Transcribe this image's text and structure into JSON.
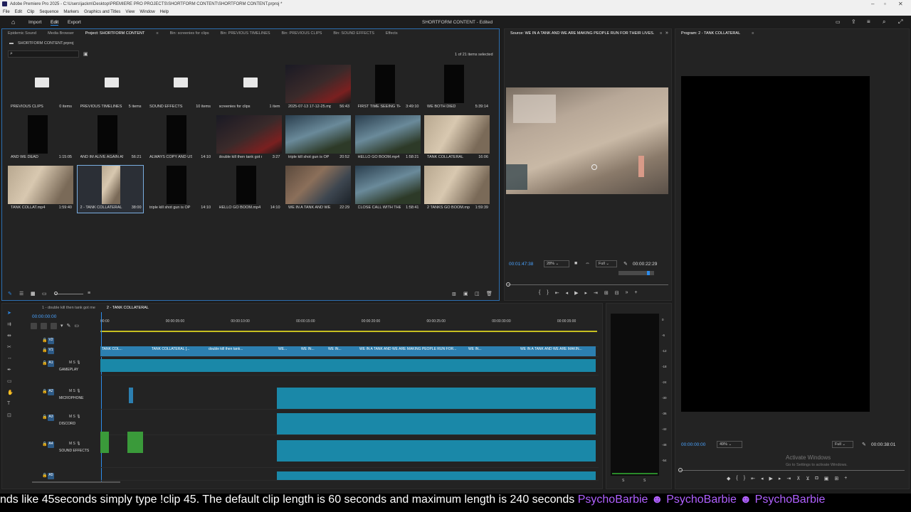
{
  "titlebar": {
    "title": "Adobe Premiere Pro 2025 - C:\\Users\\jackm\\Desktop\\PREMIERE PRO PROJECTS\\SHORTFORM CONTENT\\SHORTFORM CONTENT.prproj *"
  },
  "menu": [
    "File",
    "Edit",
    "Clip",
    "Sequence",
    "Markers",
    "Graphics and Titles",
    "View",
    "Window",
    "Help"
  ],
  "appbar": {
    "import": "Import",
    "edit": "Edit",
    "export": "Export",
    "project_title": "SHORTFORM CONTENT - Edited"
  },
  "project_tabs": [
    "Epidemic Sound",
    "Media Browser",
    "Project: SHORTFORM CONTENT",
    "Bin: screenies for clips",
    "Bin: PREVIOUS TIMELINES",
    "Bin: PREVIOUS CLIPS",
    "Bin: SOUND EFFECTS",
    "Effects"
  ],
  "project": {
    "file": "SHORTFORM CONTENT.prproj",
    "selected": "1 of 21 items selected",
    "search_placeholder": ""
  },
  "items": [
    {
      "name": "PREVIOUS CLIPS",
      "dur": "0 items",
      "kind": "folder"
    },
    {
      "name": "PREVIOUS TIMELINES",
      "dur": "5 items",
      "kind": "folder"
    },
    {
      "name": "SOUND EFFECTS",
      "dur": "10 items",
      "kind": "folder"
    },
    {
      "name": "screenies for clips",
      "dur": "1 item",
      "kind": "folder"
    },
    {
      "name": "2025-07-13 17-12-25.mp4",
      "dur": "56:43",
      "kind": "game4"
    },
    {
      "name": "FIRST TIME SEEING THE ...",
      "dur": "3:49:10",
      "kind": "dark"
    },
    {
      "name": "WE BOTH DIED",
      "dur": "5:39:14",
      "kind": "dark"
    },
    {
      "name": "AND WE DEAD",
      "dur": "1:15:05",
      "kind": "dark"
    },
    {
      "name": "AND IM ALIVE AGAIN AND...",
      "dur": "56:21",
      "kind": "dark"
    },
    {
      "name": "ALWAYS COPY AND USE F...",
      "dur": "14:10",
      "kind": "dark"
    },
    {
      "name": "double kill then tank got me",
      "dur": "3:27",
      "kind": "game4"
    },
    {
      "name": "triple kill shot gun is OP",
      "dur": "20:52",
      "kind": "game2"
    },
    {
      "name": "HELLO GO BOOM.mp4",
      "dur": "1:58:21",
      "kind": "game2"
    },
    {
      "name": "TANK COLLATERAL",
      "dur": "16:06",
      "kind": "game3"
    },
    {
      "name": "TANK COLLAT.mp4",
      "dur": "1:59:40",
      "kind": "game3"
    },
    {
      "name": "2 - TANK COLLATERAL",
      "dur": "38:00",
      "kind": "game3"
    },
    {
      "name": "triple kill shot gun is OP",
      "dur": "14:10",
      "kind": "dark"
    },
    {
      "name": "HELLO GO BOOM.mp4",
      "dur": "14:10",
      "kind": "dark"
    },
    {
      "name": "WE IN A TANK AND WE AR...",
      "dur": "22:29",
      "kind": "game"
    },
    {
      "name": "CLOSE CALL WITH THE ...",
      "dur": "1:58:41",
      "kind": "game2"
    },
    {
      "name": "2 TANKS GO BOOM.mp4",
      "dur": "1:59:39",
      "kind": "game3"
    }
  ],
  "source": {
    "tab": "Source: WE IN A TANK AND WE ARE MAKING PEOPLE RUN FOR THEIR LIVES.mp4",
    "timecode": "00:01:47:38",
    "zoom": "28%",
    "quality": "Full",
    "duration": "00:00:22:29"
  },
  "program": {
    "tab": "Program: 2 - TANK COLLATERAL",
    "timecode": "00:00:00:00",
    "zoom": "49%",
    "quality": "Full",
    "duration": "00:00:38:01",
    "watermark1": "Activate Windows",
    "watermark2": "Go to Settings to activate Windows."
  },
  "timeline": {
    "tab1": "1 - double kill then tank got me",
    "tab2": "2 - TANK COLLATERAL",
    "timecode": "00:00:00:00",
    "ruler": [
      "00:00",
      "00:00:05:00",
      "00:00:10:00",
      "00:00:15:00",
      "00:00:20:00",
      "00:00:25:00",
      "00:00:30:00",
      "00:00:35:00"
    ],
    "tracks": [
      "V2",
      "V1",
      "A1",
      "A2",
      "A3",
      "A4",
      "A5"
    ],
    "track_names": [
      "GAMEPLAY",
      "MICROPHONE",
      "DISCORD",
      "SOUND EFFECTS"
    ],
    "clip_labels": [
      "TANK COL...",
      "TANK COLLATERAL [...",
      "double kill then tank...",
      "WE...",
      "WE IN...",
      "WE IN...",
      "WE IN A TANK AND WE ARE MAKING PEOPLE RUN FOR...",
      "WE IN...",
      "WE IN A TANK AND WE ARE MAKIN..."
    ]
  },
  "meter": {
    "labels": [
      "0",
      "-6",
      "-12",
      "-18",
      "-24",
      "-30",
      "-36",
      "-42",
      "-48",
      "-54"
    ],
    "bottom": [
      "S",
      "S"
    ]
  },
  "ticker": {
    "text": "nds like 45seconds simply type !clip 45. The default clip length is 60 seconds and maximum length is 240 seconds ",
    "user1": "PsychoBarbie",
    "user2": "PsychoBarbie",
    "user3": "PsychoBarbie"
  },
  "colors": {
    "accent": "#2d8ceb",
    "video_clip": "#2c7fb0",
    "audio_clip": "#1a88a8",
    "purple": "#b060ff"
  }
}
